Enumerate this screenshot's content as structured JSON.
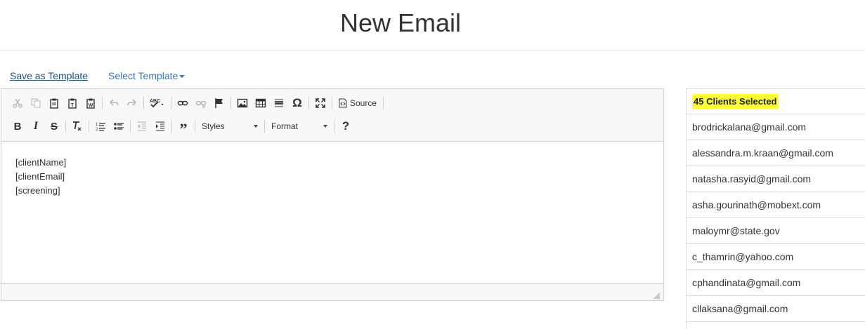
{
  "page": {
    "title": "New Email"
  },
  "templates": {
    "save_label": "Save as Template",
    "select_label": "Select Template"
  },
  "toolbar": {
    "source_label": "Source",
    "styles_label": "Styles",
    "format_label": "Format",
    "help_label": "?",
    "icons_row1": [
      "cut-icon",
      "copy-icon",
      "paste-icon",
      "paste-text-icon",
      "paste-word-icon",
      "undo-icon",
      "redo-icon",
      "spellcheck-icon",
      "link-icon",
      "unlink-icon",
      "anchor-icon",
      "image-icon",
      "table-icon",
      "horizontal-line-icon",
      "special-char-icon",
      "maximize-icon",
      "source-icon"
    ],
    "icons_row2": [
      "bold-icon",
      "italic-icon",
      "strike-icon",
      "remove-format-icon",
      "numbered-list-icon",
      "bulleted-list-icon",
      "outdent-icon",
      "indent-icon",
      "blockquote-icon"
    ]
  },
  "editor": {
    "lines": [
      "[clientName]",
      "[clientEmail]",
      "[screening]"
    ]
  },
  "clients": {
    "header": "45 Clients Selected",
    "highlight_color": "#ffff33",
    "emails": [
      "brodrickalana@gmail.com",
      "alessandra.m.kraan@gmail.com",
      "natasha.rasyid@gmail.com",
      "asha.gourinath@mobext.com",
      "maloymr@state.gov",
      "c_thamrin@yahoo.com",
      "cphandinata@gmail.com",
      "cllaksana@gmail.com"
    ]
  }
}
